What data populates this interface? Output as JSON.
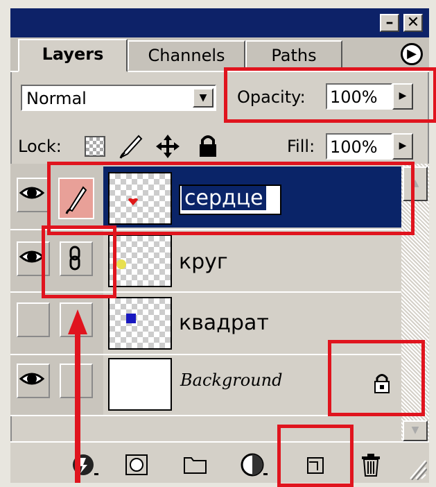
{
  "tabs": {
    "layers": "Layers",
    "channels": "Channels",
    "paths": "Paths"
  },
  "window": {
    "minimize": "–",
    "close": "✕",
    "menu_glyph": "▶"
  },
  "blend_mode": "Normal",
  "opacity": {
    "label": "Opacity:",
    "value": "100%"
  },
  "lock": {
    "label": "Lock:"
  },
  "fill": {
    "label": "Fill:",
    "value": "100%"
  },
  "layers": [
    {
      "name": "сердце",
      "visible": true,
      "selected": true,
      "dot_color": "#e01818"
    },
    {
      "name": "круг",
      "visible": true,
      "linked": true,
      "dot_color": "#e8e050"
    },
    {
      "name": "квадрат",
      "visible": false,
      "dot_color": "#1818c0"
    },
    {
      "name": "Background",
      "visible": true,
      "locked": true
    }
  ],
  "colors": {
    "selection": "#0a2468",
    "title": "#0d2268",
    "annotation": "#e0141e"
  }
}
